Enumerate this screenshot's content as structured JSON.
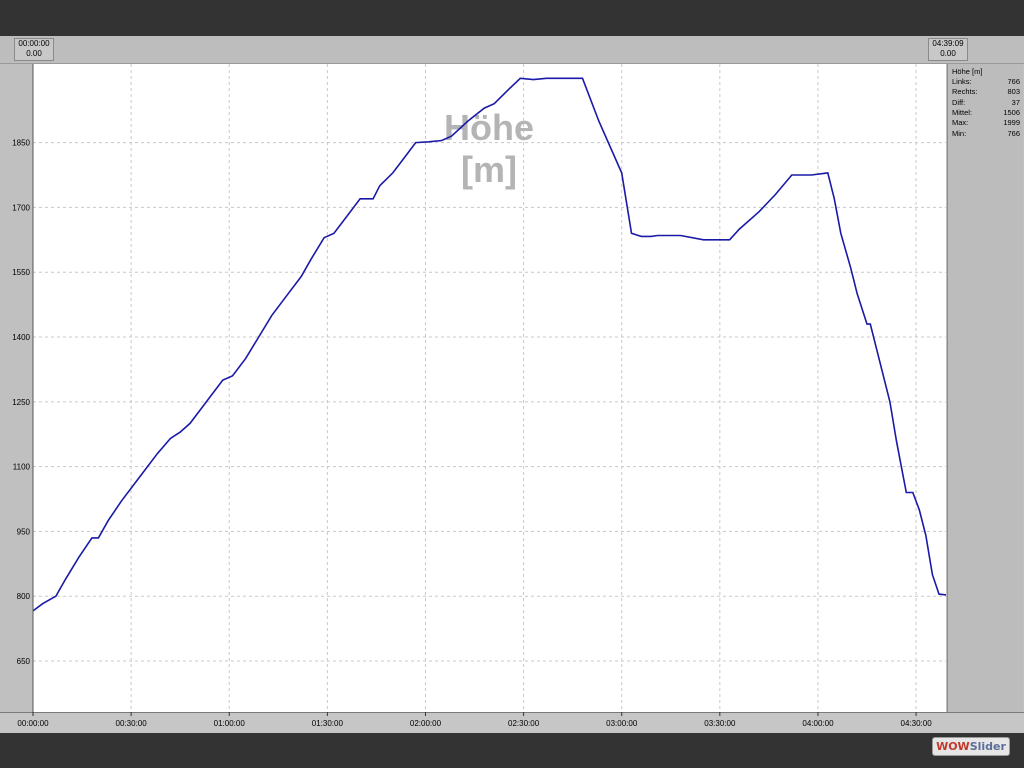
{
  "top_left": {
    "time": "00:00:00",
    "value": "0.00"
  },
  "top_right": {
    "time": "04:39:09",
    "value": "0.00"
  },
  "stats": {
    "title": "Höhe [m]",
    "rows": [
      {
        "label": "Links:",
        "value": "766"
      },
      {
        "label": "Rechts:",
        "value": "803"
      },
      {
        "label": "Diff:",
        "value": "37"
      },
      {
        "label": "Mittel:",
        "value": "1506"
      },
      {
        "label": "Max:",
        "value": "1999"
      },
      {
        "label": "Min:",
        "value": "766"
      }
    ]
  },
  "watermark": {
    "part1": "WOW",
    "part2": "Slider"
  },
  "colors": {
    "line": "#1a1aa8",
    "plot_bg": "#ffffff",
    "grid": "#c8c8c8"
  },
  "chart_data": {
    "type": "line",
    "title": "Höhe [m]",
    "title_lines": [
      "Höhe",
      "[m]"
    ],
    "x_unit": "minutes",
    "xlim": [
      0,
      279.15
    ],
    "ylim": [
      532,
      2032
    ],
    "grid": true,
    "xticks": [
      {
        "v": 0,
        "label": "00:00:00"
      },
      {
        "v": 30,
        "label": "00:30:00"
      },
      {
        "v": 60,
        "label": "01:00:00"
      },
      {
        "v": 90,
        "label": "01:30:00"
      },
      {
        "v": 120,
        "label": "02:00:00"
      },
      {
        "v": 150,
        "label": "02:30:00"
      },
      {
        "v": 180,
        "label": "03:00:00"
      },
      {
        "v": 210,
        "label": "03:30:00"
      },
      {
        "v": 240,
        "label": "04:00:00"
      },
      {
        "v": 270,
        "label": "04:30:00"
      }
    ],
    "yticks": [
      {
        "v": 650,
        "label": "650"
      },
      {
        "v": 800,
        "label": "800"
      },
      {
        "v": 950,
        "label": "950"
      },
      {
        "v": 1100,
        "label": "1100"
      },
      {
        "v": 1250,
        "label": "1250"
      },
      {
        "v": 1400,
        "label": "1400"
      },
      {
        "v": 1550,
        "label": "1550"
      },
      {
        "v": 1700,
        "label": "1700"
      },
      {
        "v": 1850,
        "label": "1850"
      }
    ],
    "series": [
      {
        "name": "Höhe [m]",
        "x": [
          0,
          3,
          7,
          10,
          14,
          18,
          20,
          23,
          27,
          31,
          35,
          38,
          42,
          45,
          48,
          51,
          54,
          58,
          61,
          65,
          69,
          73,
          78,
          82,
          85,
          89,
          92,
          96,
          100,
          104,
          106,
          110,
          114,
          117,
          121,
          125,
          128,
          133,
          138,
          141,
          145,
          149,
          153,
          157,
          162,
          168,
          173,
          180,
          183,
          186,
          189,
          191,
          193,
          198,
          205,
          213,
          216,
          222,
          227,
          232,
          238,
          243,
          245,
          247,
          250,
          252,
          255,
          256,
          259,
          262,
          264,
          266,
          267,
          269,
          271,
          273,
          275,
          277,
          279.15
        ],
        "y": [
          766,
          783,
          800,
          840,
          890,
          935,
          935,
          975,
          1020,
          1060,
          1100,
          1130,
          1165,
          1180,
          1200,
          1230,
          1260,
          1300,
          1310,
          1350,
          1400,
          1450,
          1500,
          1540,
          1580,
          1630,
          1640,
          1680,
          1720,
          1720,
          1750,
          1780,
          1820,
          1850,
          1852,
          1855,
          1865,
          1900,
          1930,
          1940,
          1970,
          1999,
          1996,
          1999,
          1999,
          1999,
          1900,
          1780,
          1640,
          1633,
          1633,
          1635,
          1635,
          1635,
          1625,
          1625,
          1650,
          1690,
          1730,
          1775,
          1775,
          1780,
          1720,
          1640,
          1560,
          1500,
          1430,
          1430,
          1340,
          1250,
          1160,
          1080,
          1040,
          1040,
          1000,
          940,
          850,
          805,
          803
        ]
      }
    ]
  }
}
